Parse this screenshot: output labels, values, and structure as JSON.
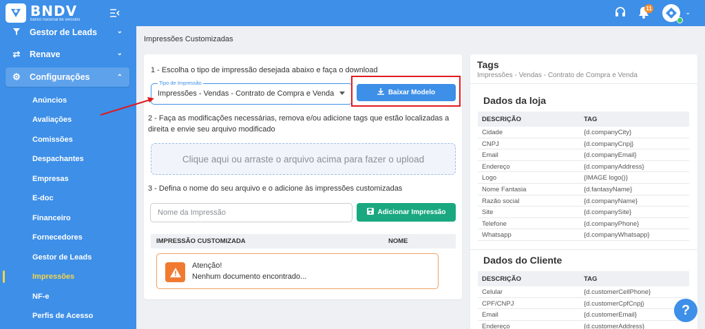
{
  "logo": {
    "name": "BNDV",
    "tagline": "banco nacional de veículos"
  },
  "sidebar": {
    "items": [
      {
        "label": "Gestor de Leads",
        "icon": "funnel-icon"
      },
      {
        "label": "Renave",
        "icon": "swap-icon"
      },
      {
        "label": "Configurações",
        "icon": "gear-icon"
      }
    ],
    "subitems": [
      "Anúncios",
      "Avaliações",
      "Comissões",
      "Despachantes",
      "Empresas",
      "E-doc",
      "Financeiro",
      "Fornecedores",
      "Gestor de Leads",
      "Impressões",
      "NF-e",
      "Perfis de Acesso"
    ],
    "current_subitem": "Impressões"
  },
  "topbar": {
    "notification_count": "11"
  },
  "page": {
    "title": "Impressões Customizadas"
  },
  "form": {
    "step1": "1 - Escolha o tipo de impressão desejada abaixo e faça o download",
    "select_label": "Tipo de Impressão",
    "select_value": "Impressões - Vendas - Contrato de Compra e Venda",
    "download_button": "Baixar Modelo",
    "step2_line1": "2 - Faça as modificações necessárias, remova e/ou adicione tags que estão localizadas a",
    "step2_line2": "direita e envie seu arquivo modificado",
    "dropzone_text": "Clique aqui ou arraste o arquivo acima para fazer o upload",
    "step3": "3 - Defina o nome do seu arquivo e o adicione às impressões customizadas",
    "name_placeholder": "Nome da Impressão",
    "add_button": "Adicionar Impressão",
    "table_headers": [
      "IMPRESSÃO CUSTOMIZADA",
      "NOME"
    ],
    "alert_title": "Atenção!",
    "alert_text": "Nenhum documento encontrado..."
  },
  "tags": {
    "title": "Tags",
    "subtitle": "Impressões - Vendas - Contrato de Compra e Venda",
    "headers": [
      "DESCRIÇÃO",
      "TAG"
    ],
    "sections": [
      {
        "title": "Dados da loja",
        "rows": [
          [
            "Cidade",
            "{d.companyCity}"
          ],
          [
            "CNPJ",
            "{d.companyCnpj}"
          ],
          [
            "Email",
            "{d.companyEmail}"
          ],
          [
            "Endereço",
            "{d.companyAddress}"
          ],
          [
            "Logo",
            "{IMAGE logo()}"
          ],
          [
            "Nome Fantasia",
            "{d.fantasyName}"
          ],
          [
            "Razão social",
            "{d.companyName}"
          ],
          [
            "Site",
            "{d.companySite}"
          ],
          [
            "Telefone",
            "{d.companyPhone}"
          ],
          [
            "Whatsapp",
            "{d.companyWhatsapp}"
          ]
        ]
      },
      {
        "title": "Dados do Cliente",
        "rows": [
          [
            "Celular",
            "{d.customerCellPhone}"
          ],
          [
            "CPF/CNPJ",
            "{d.customerCpfCnpj}"
          ],
          [
            "Email",
            "{d.customerEmail}"
          ],
          [
            "Endereço",
            "{d.customerAddress}"
          ]
        ]
      }
    ]
  },
  "colors": {
    "primary": "#3d8fe8",
    "success": "#1aa880",
    "warning": "#f07a30",
    "highlight": "#e0191e",
    "active_sub": "#f7d44a"
  }
}
